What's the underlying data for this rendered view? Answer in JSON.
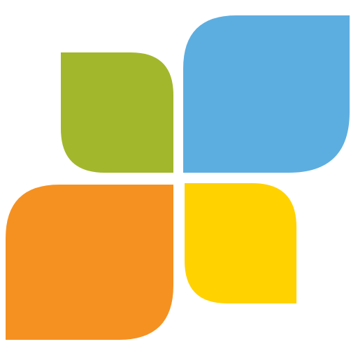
{
  "logo": {
    "name": "four-petal-logo-icon",
    "petals": [
      {
        "id": "green",
        "color": "#A3B72C"
      },
      {
        "id": "blue",
        "color": "#5DAEE0"
      },
      {
        "id": "orange",
        "color": "#F59121"
      },
      {
        "id": "yellow",
        "color": "#FFD200"
      }
    ],
    "background": "#FFFFFF"
  }
}
